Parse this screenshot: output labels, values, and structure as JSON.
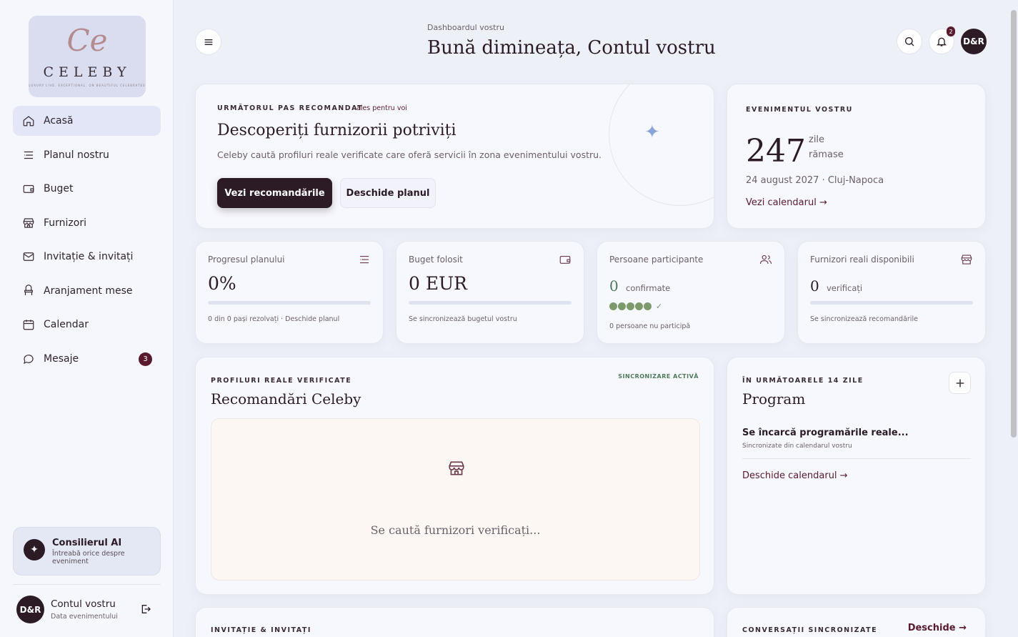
{
  "sidebar": {
    "logo": {
      "monogram": "Ce",
      "wordmark": "CELEBY",
      "tagline": "LUXURY LIVE. EXCEPTIONAL. ON BEAUTIFUL CELEBRATES"
    },
    "items": [
      {
        "label": "Acasă",
        "icon": "home-icon",
        "active": true
      },
      {
        "label": "Planul nostru",
        "icon": "list-icon"
      },
      {
        "label": "Buget",
        "icon": "wallet-icon"
      },
      {
        "label": "Furnizori",
        "icon": "store-icon"
      },
      {
        "label": "Invitație & invitați",
        "icon": "mail-icon"
      },
      {
        "label": "Aranjament mese",
        "icon": "chair-icon"
      },
      {
        "label": "Calendar",
        "icon": "calendar-icon"
      },
      {
        "label": "Mesaje",
        "icon": "chat-icon",
        "badge": "3"
      }
    ],
    "ai": {
      "title": "Consilierul AI",
      "subtitle": "Întreabă orice despre eveniment"
    },
    "user": {
      "initials": "D&R",
      "name": "Contul vostru",
      "subtitle": "Data evenimentului"
    }
  },
  "header": {
    "eyebrow": "Dashboardul vostru",
    "greeting": "Bună dimineața, Contul vostru",
    "notifications": "2",
    "avatar": "D&R"
  },
  "next_step": {
    "eyebrow": "URMĂTORUL PAS RECOMANDAT",
    "tag": "ales pentru voi",
    "title": "Descoperiți furnizorii potriviți",
    "text": "Celeby caută profiluri reale verificate care oferă servicii în zona evenimentului vostru.",
    "primary": "Vezi recomandările",
    "secondary": "Deschide planul"
  },
  "event": {
    "eyebrow": "EVENIMENTUL VOSTRU",
    "days": "247",
    "days_label_1": "zile",
    "days_label_2": "rămase",
    "date": "24 august 2027 · Cluj-Napoca",
    "link": "Vezi calendarul →"
  },
  "stats": [
    {
      "label": "Progresul planului",
      "value": "0%",
      "foot": "0 din 0 pași rezolvați · Deschide planul",
      "icon": "list-icon",
      "progress": 0
    },
    {
      "label": "Buget folosit",
      "value": "0 EUR",
      "foot": "Se sincronizează bugetul vostru",
      "icon": "wallet-icon",
      "progress": 0
    },
    {
      "label": "Persoane participante",
      "value": "0",
      "unit": "confirmate",
      "foot": "0 persoane nu participă",
      "icon": "users-icon",
      "check": "✓"
    },
    {
      "label": "Furnizori reali disponibili",
      "value": "0",
      "unit": "verificați",
      "foot": "Se sincronizează recomandările",
      "icon": "store-icon",
      "progress": 0
    }
  ],
  "recommendations": {
    "eyebrow": "PROFILURI REALE VERIFICATE",
    "status": "SINCRONIZARE ACTIVĂ",
    "title": "Recomandări Celeby",
    "loading": "Se caută furnizori verificați..."
  },
  "program": {
    "eyebrow": "ÎN URMĂTOARELE 14 ZILE",
    "title": "Program",
    "loading": "Se încarcă programările reale...",
    "sub": "Sincronizate din calendarul vostru",
    "link": "Deschide calendarul →"
  },
  "invites": {
    "eyebrow": "INVITAȚIE & INVITAȚI"
  },
  "conversations": {
    "eyebrow": "CONVERSAȚII SINCRONIZATE",
    "link": "Deschide →"
  },
  "colors": {
    "accent": "#2c1a24",
    "badge": "#5a1a2e",
    "sparkle": "#8aa3d8",
    "success": "#7d9a6a",
    "status": "#4f7a5a"
  }
}
